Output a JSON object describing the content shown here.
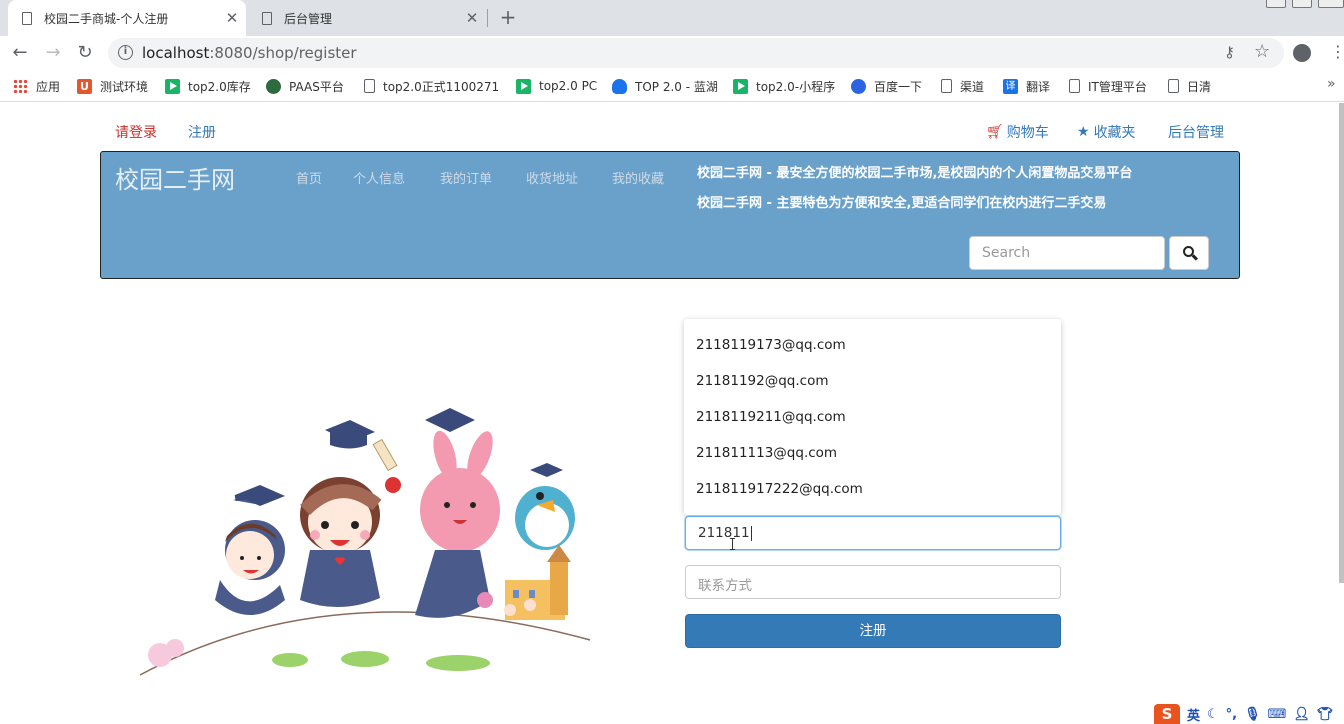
{
  "browser": {
    "tabs": [
      {
        "title": "校园二手商城-个人注册",
        "active": true
      },
      {
        "title": "后台管理",
        "active": false
      }
    ],
    "url_host": "localhost",
    "url_rest": ":8080/shop/register",
    "bookmarks": [
      {
        "label": "应用",
        "icon": "apps-grid-icon"
      },
      {
        "label": "测试环境",
        "icon": "u-logo-icon"
      },
      {
        "label": "top2.0库存",
        "icon": "play-icon"
      },
      {
        "label": "PAAS平台",
        "icon": "globe-icon"
      },
      {
        "label": "top2.0正式1100271",
        "icon": "page-icon"
      },
      {
        "label": "top2.0 PC",
        "icon": "play-icon"
      },
      {
        "label": "TOP 2.0 - 蓝湖",
        "icon": "bird-icon"
      },
      {
        "label": "top2.0-小程序",
        "icon": "play-icon"
      },
      {
        "label": "百度一下",
        "icon": "paw-icon"
      },
      {
        "label": "渠道",
        "icon": "page-icon"
      },
      {
        "label": "翻译",
        "icon": "translate-icon"
      },
      {
        "label": "IT管理平台",
        "icon": "page-icon"
      },
      {
        "label": "日清",
        "icon": "page-icon"
      }
    ],
    "bookmarks_more": "»"
  },
  "topbar": {
    "login": "请登录",
    "register": "注册",
    "cart": "购物车",
    "favorites": "收藏夹",
    "admin": "后台管理"
  },
  "banner": {
    "brand": "校园二手网",
    "nav": [
      "首页",
      "个人信息",
      "我的订单",
      "收货地址",
      "我的收藏"
    ],
    "slogan1": "校园二手网 - 最安全方便的校园二手市场,是校园内的个人闲置物品交易平台",
    "slogan2": "校园二手网 - 主要特色为方便和安全,更适合同学们在校内进行二手交易",
    "search_placeholder": "Search"
  },
  "form": {
    "suggestions": [
      "2118119173@qq.com",
      "21181192@qq.com",
      "2118119211@qq.com",
      "211811113@qq.com",
      "211811917222@qq.com"
    ],
    "email_value": "211811",
    "contact_placeholder": "联系方式",
    "submit_label": "注册"
  },
  "ime": {
    "logo": "S",
    "mode": "英"
  }
}
